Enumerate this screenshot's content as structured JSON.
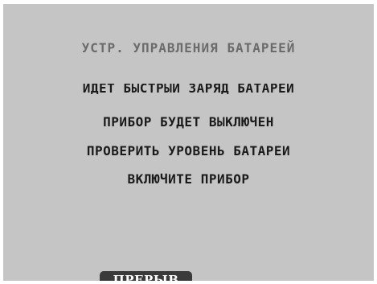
{
  "screen": {
    "title": "УСТР. УПРАВЛЕНИЯ БАТАРЕЕЙ",
    "messages": [
      "ИДЕТ БЫСТРЫЙ ЗАРЯД БАТАРЕИ",
      "ПРИБОР БУДЕТ ВЫКЛЮЧЕН",
      "ПРОВЕРИТЬ УРОВЕНЬ БАТАРЕИ",
      "ВКЛЮЧИТЕ ПРИБОР"
    ]
  },
  "softkeys": {
    "abort_label": "ПРЕРЫВ"
  },
  "colors": {
    "screen_background": "#c5c5c5",
    "title_text": "#6b6b6b",
    "message_text": "#1a1a1a",
    "softkey_background": "#3a3a3a",
    "softkey_text": "#ffffff"
  }
}
